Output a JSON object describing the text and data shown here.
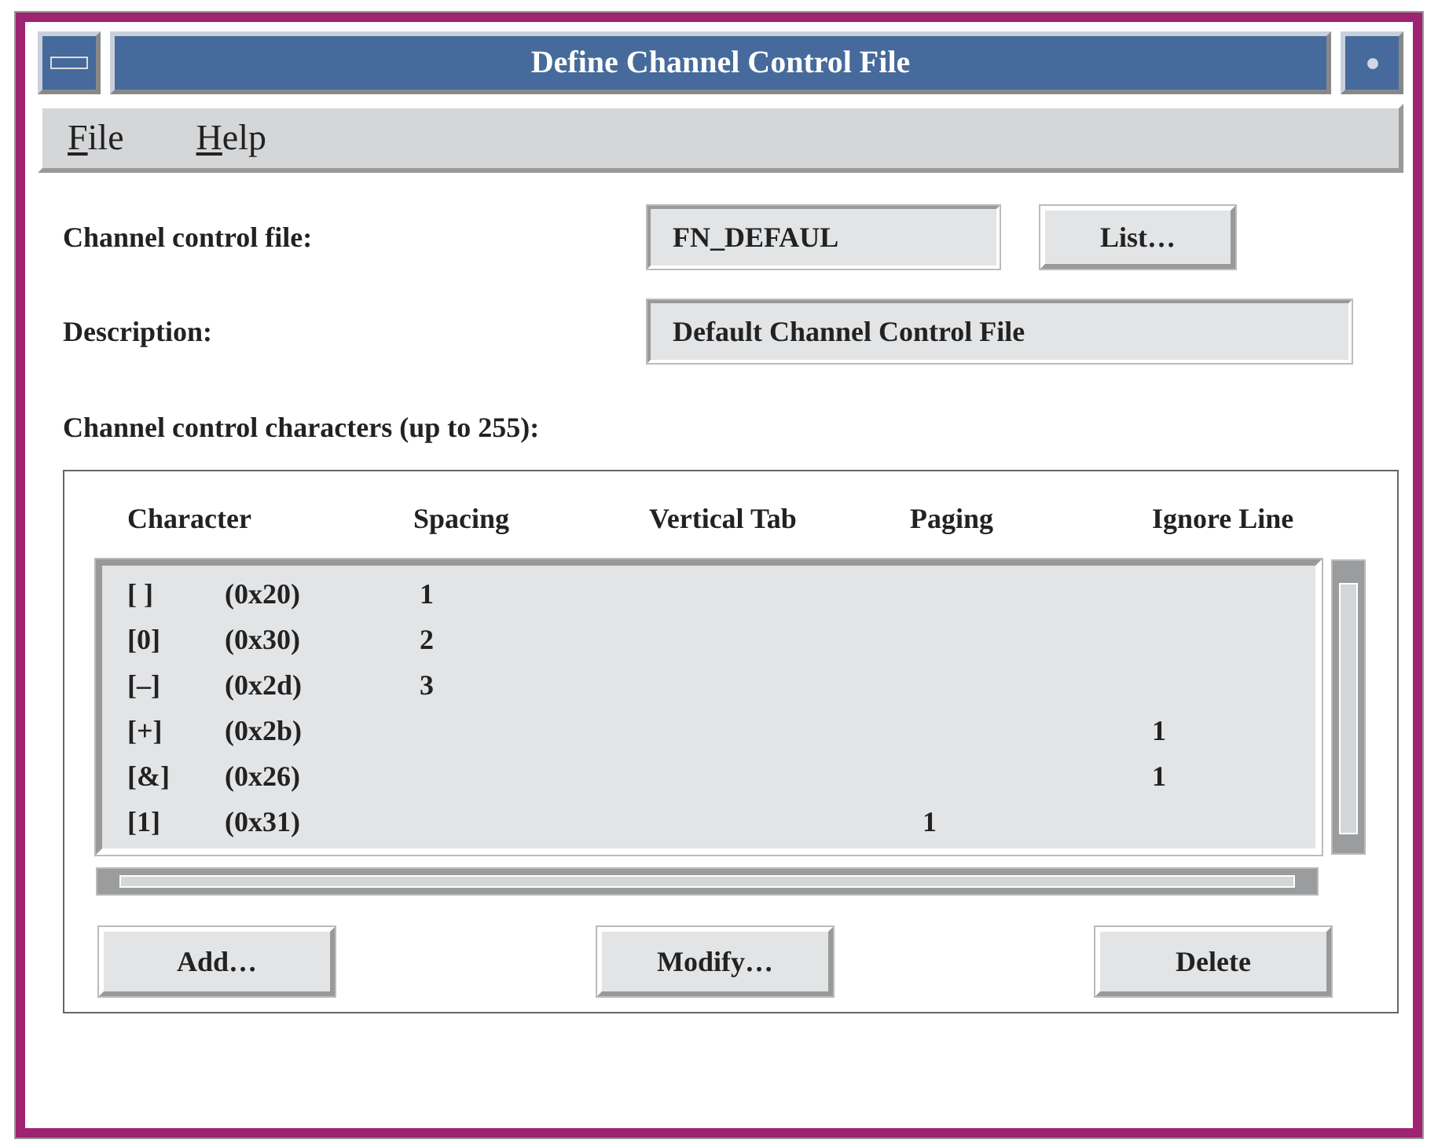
{
  "window": {
    "title": "Define Channel Control File"
  },
  "menu": [
    {
      "label": "File"
    },
    {
      "label": "Help"
    }
  ],
  "form": {
    "file_label": "Channel control file:",
    "file_value": "FN_DEFAUL",
    "list_button": "List…",
    "description_label": "Description:",
    "description_value": "Default Channel Control File",
    "characters_label": "Channel control characters (up to 255):"
  },
  "table": {
    "columns": [
      "Character",
      "Spacing",
      "Vertical Tab",
      "Paging",
      "Ignore Line"
    ],
    "rows": [
      {
        "character": "[ ]",
        "code": "(0x20)",
        "spacing": "1"
      },
      {
        "character": "[0]",
        "code": "(0x30)",
        "spacing": "2"
      },
      {
        "character": "[–]",
        "code": "(0x2d)",
        "spacing": "3"
      },
      {
        "character": "[+]",
        "code": "(0x2b)",
        "ignore_line": "1"
      },
      {
        "character": "[&]",
        "code": "(0x26)",
        "ignore_line": "1"
      },
      {
        "character": "[1]",
        "code": "(0x31)",
        "paging": "1"
      }
    ]
  },
  "buttons": [
    "Add…",
    "Modify…",
    "Delete"
  ]
}
